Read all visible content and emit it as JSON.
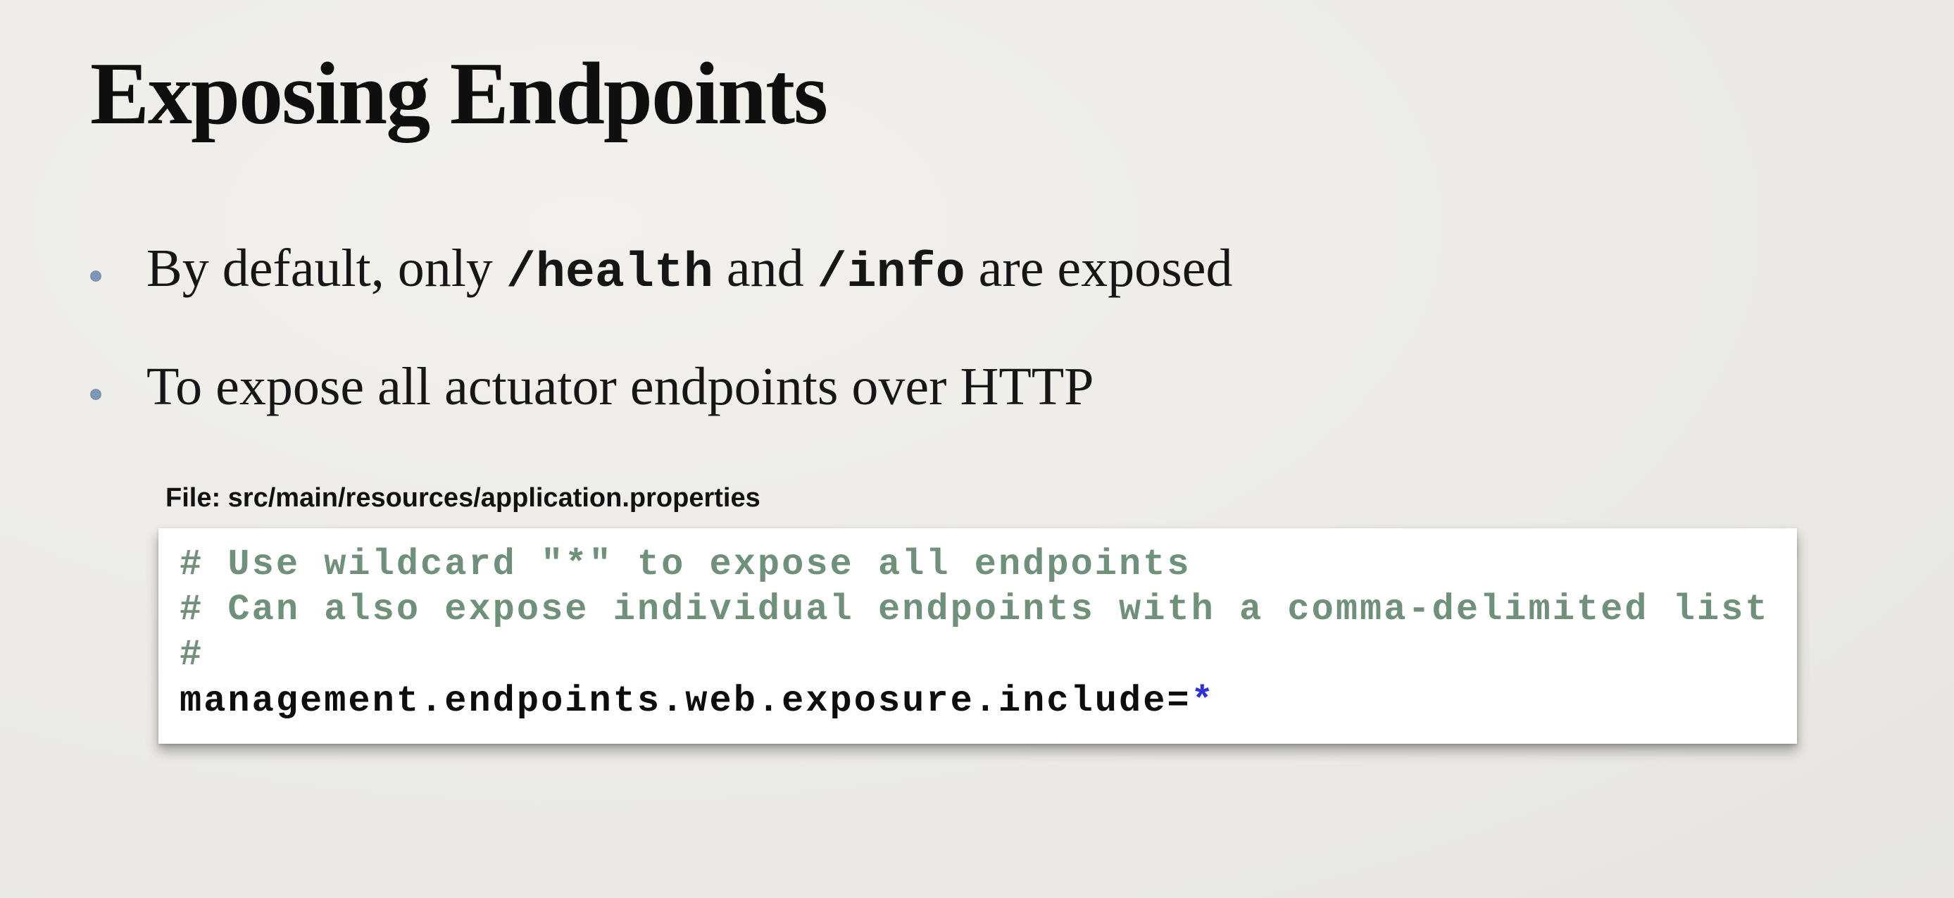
{
  "slide": {
    "title": "Exposing Endpoints",
    "bullets": [
      {
        "text_1": "By default, only ",
        "code_1": "/health",
        "text_2": " and ",
        "code_2": "/info",
        "text_3": "  are exposed"
      },
      {
        "text": "To expose all actuator endpoints over HTTP"
      }
    ],
    "file_label": "File: src/main/resources/application.properties",
    "code": {
      "comment_lines": [
        "# Use wildcard \"*\" to expose all endpoints",
        "# Can also expose individual endpoints with a comma-delimited list",
        "#"
      ],
      "property_key": "management.endpoints.web.exposure.include=",
      "property_value": "*"
    },
    "colors": {
      "bullet_dot": "#7f97b6",
      "comment": "#6f9079",
      "value_highlight": "#2c34d8"
    }
  }
}
